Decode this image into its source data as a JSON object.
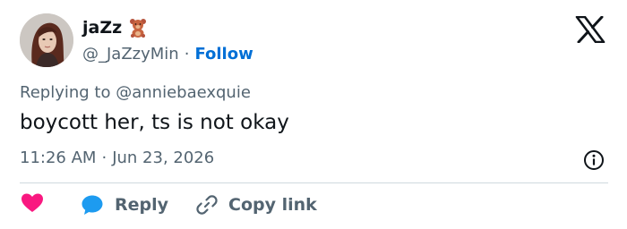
{
  "author": {
    "display_name": "jaZz",
    "handle": "@_JaZzyMin",
    "follow_label": "Follow",
    "name_emoji": "teddy-bear-icon"
  },
  "separator": "·",
  "reply_context": {
    "prefix": "Replying to",
    "mention": "@anniebaexquie"
  },
  "tweet": {
    "text": "boycott her, ts is not okay",
    "time": "11:26 AM",
    "date": "Jun 23, 2026"
  },
  "actions": {
    "like_icon": "heart-icon",
    "reply_label": "Reply",
    "copy_link_label": "Copy link"
  },
  "icons": {
    "brand": "x-logo-icon",
    "info": "info-icon",
    "reply": "speech-bubble-icon",
    "link": "link-icon"
  },
  "colors": {
    "text": "#0f1419",
    "muted": "#536471",
    "follow": "#006fd6",
    "like": "#f91880",
    "reply": "#1d9bf0",
    "divider": "#cfd9de"
  }
}
